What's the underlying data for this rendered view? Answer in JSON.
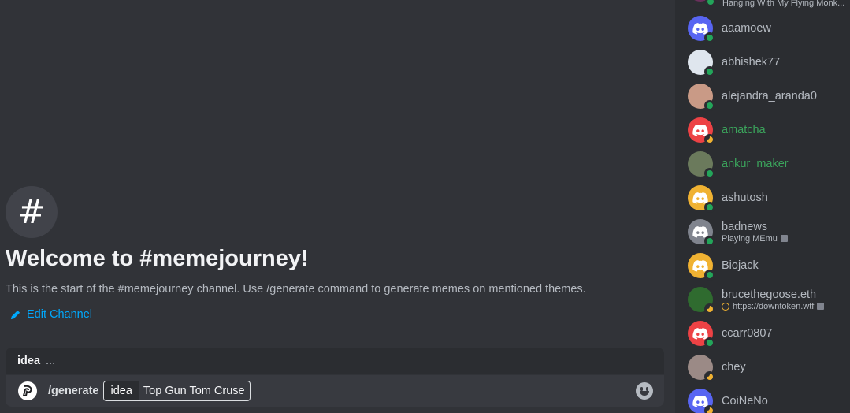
{
  "channel": {
    "hash_icon": "hash-icon",
    "welcome_title": "Welcome to #memejourney!",
    "welcome_sub": "This is the start of the #memejourney channel. Use /generate command to generate memes on mentioned themes.",
    "edit_label": "Edit Channel"
  },
  "composer": {
    "option_hint_name": "idea",
    "option_hint_desc": "...",
    "command": "/generate",
    "option_name": "idea",
    "option_value": "Top Gun Tom Cruse"
  },
  "member_list": {
    "top_activity": "Hanging With My Flying Monk...",
    "members": [
      {
        "name": "aaamoew",
        "color": "#5865f2",
        "status": "online",
        "avatar_type": "discord"
      },
      {
        "name": "abhishek77",
        "color": "#dfe6ee",
        "status": "online",
        "avatar_type": "photo"
      },
      {
        "name": "alejandra_aranda0",
        "color": "#c99a86",
        "status": "online",
        "avatar_type": "photo"
      },
      {
        "name": "amatcha",
        "color": "#ed4245",
        "status": "idle",
        "avatar_type": "discord",
        "highlight": true
      },
      {
        "name": "ankur_maker",
        "color": "#6b7a5c",
        "status": "online",
        "avatar_type": "photo",
        "highlight": true
      },
      {
        "name": "ashutosh",
        "color": "#f0b232",
        "status": "online",
        "avatar_type": "discord"
      },
      {
        "name": "badnews",
        "activity": "Playing MEmu",
        "color": "#80848e",
        "status": "online",
        "avatar_type": "discord"
      },
      {
        "name": "Biojack",
        "color": "#f0b232",
        "status": "online",
        "avatar_type": "discord"
      },
      {
        "name": "brucethegoose.eth",
        "activity": "https://downtoken.wtf",
        "color": "#2f6b2f",
        "status": "idle",
        "avatar_type": "photo"
      },
      {
        "name": "ccarr0807",
        "color": "#ed4245",
        "status": "online",
        "avatar_type": "discord"
      },
      {
        "name": "chey",
        "color": "#9b8a86",
        "status": "idle",
        "avatar_type": "photo"
      },
      {
        "name": "CoiNeNo",
        "color": "#5865f2",
        "status": "idle",
        "avatar_type": "discord"
      }
    ]
  }
}
